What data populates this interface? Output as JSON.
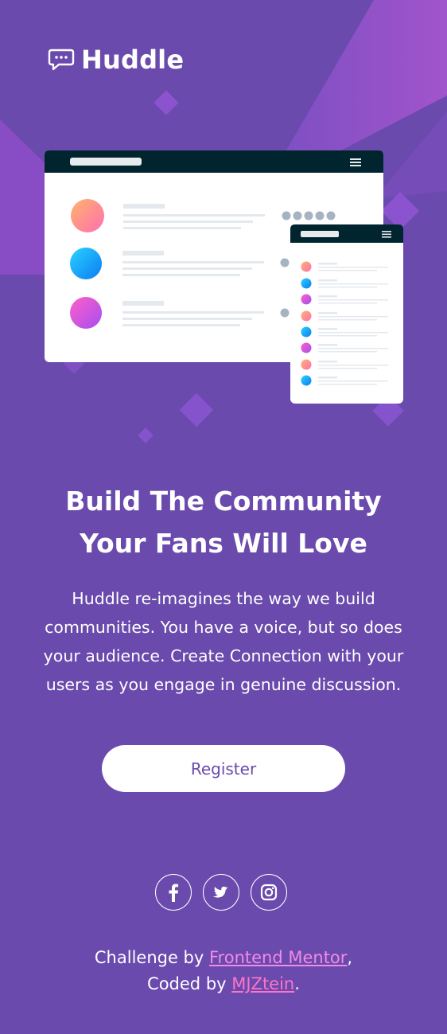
{
  "brand": {
    "name": "Huddle",
    "logo_icon": "chat-bubble-icon"
  },
  "hero": {
    "heading_line1": "Build The Community",
    "heading_line2": "Your Fans Will Love",
    "description": "Huddle re-imagines the way we build communities. You have a voice, but so does your audience. Create Connection with your users as you engage in genuine discussion.",
    "cta_label": "Register"
  },
  "social": [
    {
      "name": "facebook",
      "icon": "facebook-icon"
    },
    {
      "name": "twitter",
      "icon": "twitter-icon"
    },
    {
      "name": "instagram",
      "icon": "instagram-icon"
    }
  ],
  "footer": {
    "prefix": "Challenge by ",
    "link1": "Frontend Mentor",
    "comma": ",",
    "coded_by": "Coded by ",
    "link2": "MJZtein",
    "period": "."
  },
  "colors": {
    "background": "#6a4aad",
    "accent_pink": "#ff73c8",
    "button_text": "#6a4aad",
    "window_bar": "#00252e"
  }
}
